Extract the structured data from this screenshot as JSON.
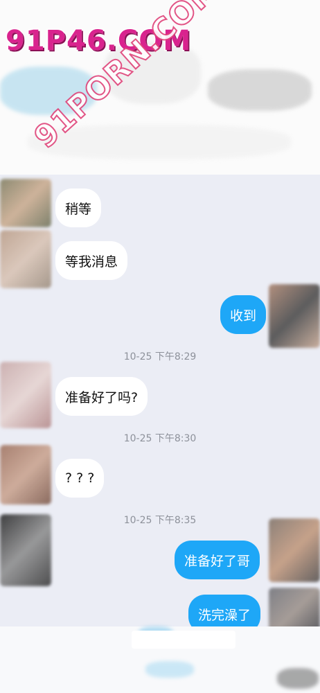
{
  "watermarks": {
    "top_logo": "91P46.COM",
    "diagonal_logo": "91PORN.COM"
  },
  "colors": {
    "chat_background": "#ebedf5",
    "outgoing_bubble": "#1ea7f7",
    "incoming_bubble": "#ffffff",
    "timestamp_text": "#8d919a",
    "watermark_pink": "#d9238e"
  },
  "messages": [
    {
      "direction": "in",
      "text": "稍等"
    },
    {
      "direction": "in",
      "text": "等我消息"
    },
    {
      "direction": "out",
      "text": "收到"
    },
    {
      "type": "timestamp",
      "text": "10-25 下午8:29"
    },
    {
      "direction": "in",
      "text": "准备好了吗?"
    },
    {
      "type": "timestamp",
      "text": "10-25 下午8:30"
    },
    {
      "direction": "in",
      "text": "? ? ?"
    },
    {
      "type": "timestamp",
      "text": "10-25 下午8:35"
    },
    {
      "direction": "out",
      "text": "准备好了哥"
    },
    {
      "direction": "out",
      "text": "洗完澡了"
    }
  ]
}
